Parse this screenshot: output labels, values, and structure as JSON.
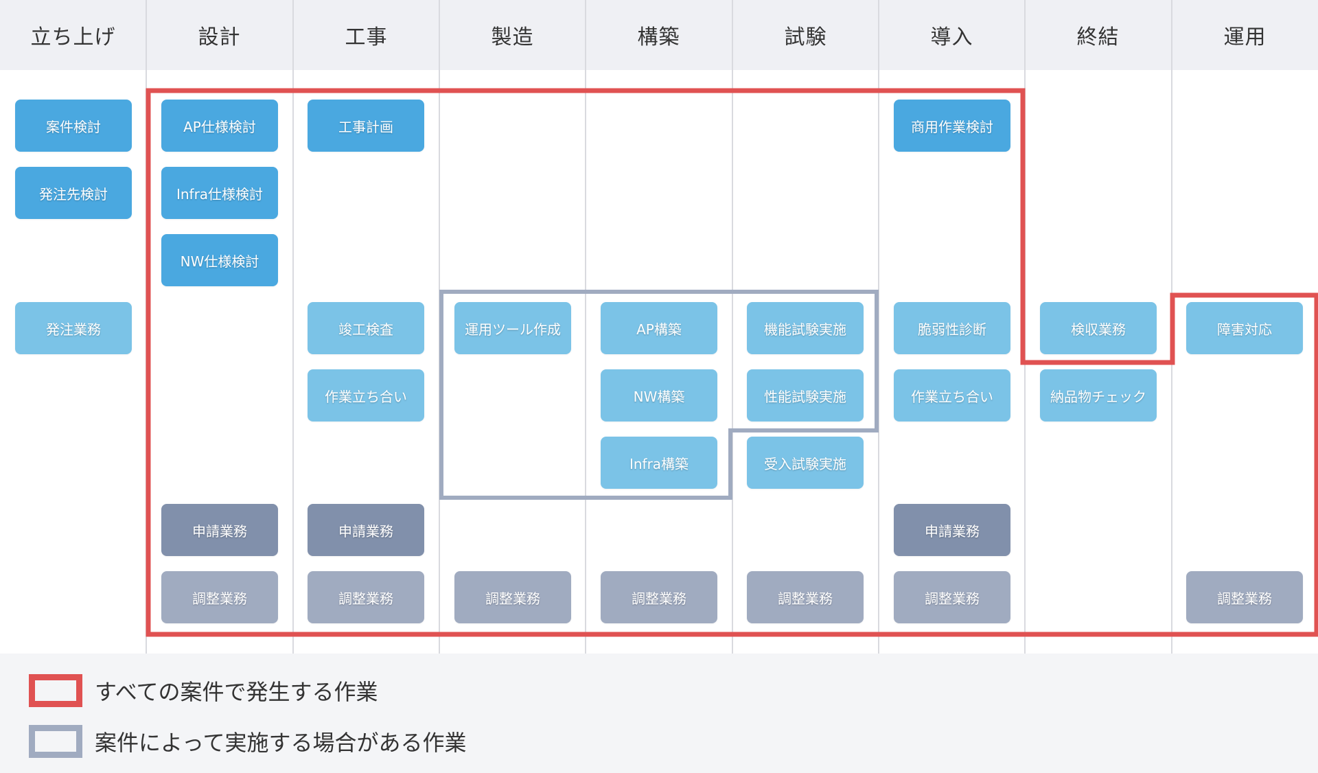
{
  "colors": {
    "header_bg": "#eff0f4",
    "primary_task": "#4aa8e0",
    "secondary_task": "#7bc3e7",
    "application_task": "#8190ab",
    "coordination_task": "#a0abc0",
    "required_frame": "#e05252",
    "optional_frame": "#a0abc0"
  },
  "phases": [
    {
      "label": "立ち上げ"
    },
    {
      "label": "設計"
    },
    {
      "label": "工事"
    },
    {
      "label": "製造"
    },
    {
      "label": "構築"
    },
    {
      "label": "試験"
    },
    {
      "label": "導入"
    },
    {
      "label": "終結"
    },
    {
      "label": "運用"
    }
  ],
  "tasks": [
    {
      "label": "案件検討",
      "phase": 0,
      "row": 0,
      "type": "primary"
    },
    {
      "label": "発注先検討",
      "phase": 0,
      "row": 1,
      "type": "primary"
    },
    {
      "label": "発注業務",
      "phase": 0,
      "row": 3,
      "type": "secondary"
    },
    {
      "label": "AP仕様検討",
      "phase": 1,
      "row": 0,
      "type": "primary"
    },
    {
      "label": "Infra仕様検討",
      "phase": 1,
      "row": 1,
      "type": "primary"
    },
    {
      "label": "NW仕様検討",
      "phase": 1,
      "row": 2,
      "type": "primary"
    },
    {
      "label": "申請業務",
      "phase": 1,
      "row": 6,
      "type": "application"
    },
    {
      "label": "調整業務",
      "phase": 1,
      "row": 7,
      "type": "coordination"
    },
    {
      "label": "工事計画",
      "phase": 2,
      "row": 0,
      "type": "primary"
    },
    {
      "label": "竣工検査",
      "phase": 2,
      "row": 3,
      "type": "secondary"
    },
    {
      "label": "作業立ち合い",
      "phase": 2,
      "row": 4,
      "type": "secondary"
    },
    {
      "label": "申請業務",
      "phase": 2,
      "row": 6,
      "type": "application"
    },
    {
      "label": "調整業務",
      "phase": 2,
      "row": 7,
      "type": "coordination"
    },
    {
      "label": "運用ツール作成",
      "phase": 3,
      "row": 3,
      "type": "secondary"
    },
    {
      "label": "調整業務",
      "phase": 3,
      "row": 7,
      "type": "coordination"
    },
    {
      "label": "AP構築",
      "phase": 4,
      "row": 3,
      "type": "secondary"
    },
    {
      "label": "NW構築",
      "phase": 4,
      "row": 4,
      "type": "secondary"
    },
    {
      "label": "Infra構築",
      "phase": 4,
      "row": 5,
      "type": "secondary"
    },
    {
      "label": "調整業務",
      "phase": 4,
      "row": 7,
      "type": "coordination"
    },
    {
      "label": "機能試験実施",
      "phase": 5,
      "row": 3,
      "type": "secondary"
    },
    {
      "label": "性能試験実施",
      "phase": 5,
      "row": 4,
      "type": "secondary"
    },
    {
      "label": "受入試験実施",
      "phase": 5,
      "row": 5,
      "type": "secondary"
    },
    {
      "label": "調整業務",
      "phase": 5,
      "row": 7,
      "type": "coordination"
    },
    {
      "label": "商用作業検討",
      "phase": 6,
      "row": 0,
      "type": "primary"
    },
    {
      "label": "脆弱性診断",
      "phase": 6,
      "row": 3,
      "type": "secondary"
    },
    {
      "label": "作業立ち合い",
      "phase": 6,
      "row": 4,
      "type": "secondary"
    },
    {
      "label": "申請業務",
      "phase": 6,
      "row": 6,
      "type": "application"
    },
    {
      "label": "調整業務",
      "phase": 6,
      "row": 7,
      "type": "coordination"
    },
    {
      "label": "検収業務",
      "phase": 7,
      "row": 3,
      "type": "secondary"
    },
    {
      "label": "納品物チェック",
      "phase": 7,
      "row": 4,
      "type": "secondary"
    },
    {
      "label": "障害対応",
      "phase": 8,
      "row": 3,
      "type": "secondary"
    },
    {
      "label": "調整業務",
      "phase": 8,
      "row": 7,
      "type": "coordination"
    }
  ],
  "legend": {
    "required": {
      "label": "すべての案件で発生する作業"
    },
    "optional": {
      "label": "案件によって実施する場合がある作業"
    }
  }
}
